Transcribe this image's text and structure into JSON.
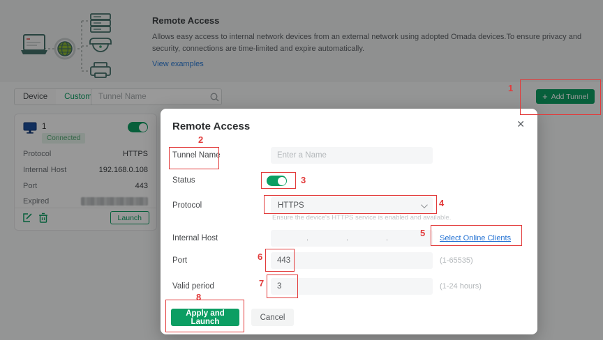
{
  "page": {
    "banner": {
      "title": "Remote Access",
      "description": "Allows easy access to internal network devices from an external network using adopted Omada devices.To ensure privacy and security, connections are time-limited and expire automatically.",
      "link": "View examples"
    },
    "toolbar": {
      "tabs": [
        {
          "label": "Device"
        },
        {
          "label": "Custom"
        }
      ],
      "search_placeholder": "Tunnel Name",
      "add_tunnel": {
        "icon": "+",
        "label": "Add Tunnel"
      }
    },
    "device_card": {
      "name": "1",
      "status_badge": "Connected",
      "toggle_on": true,
      "rows": [
        {
          "label": "Protocol",
          "value": "HTTPS"
        },
        {
          "label": "Internal Host",
          "value": "192.168.0.108"
        },
        {
          "label": "Port",
          "value": "443"
        },
        {
          "label": "Expired",
          "value": ""
        }
      ],
      "launch_label": "Launch"
    }
  },
  "modal": {
    "title": "Remote Access",
    "fields": {
      "tunnel_name": {
        "label": "Tunnel Name",
        "placeholder": "Enter a Name"
      },
      "status": {
        "label": "Status",
        "on": true
      },
      "protocol": {
        "label": "Protocol",
        "value": "HTTPS",
        "helper": "Ensure the device's HTTPS service is enabled and available."
      },
      "internal_host": {
        "label": "Internal Host",
        "separator": ".",
        "link": "Select Online Clients"
      },
      "port": {
        "label": "Port",
        "value": "443",
        "hint": "(1-65535)"
      },
      "valid_period": {
        "label": "Valid period",
        "value": "3",
        "hint": "(1-24 hours)"
      }
    },
    "buttons": {
      "apply": "Apply and Launch",
      "cancel": "Cancel"
    }
  },
  "icons": {
    "close": "✕"
  },
  "annotations": {
    "steps": [
      "1",
      "2",
      "3",
      "4",
      "5",
      "6",
      "7",
      "8"
    ]
  },
  "colors": {
    "green": "#0c9e63",
    "annotation_red": "#e23b3b",
    "link_blue": "#2271d3"
  }
}
